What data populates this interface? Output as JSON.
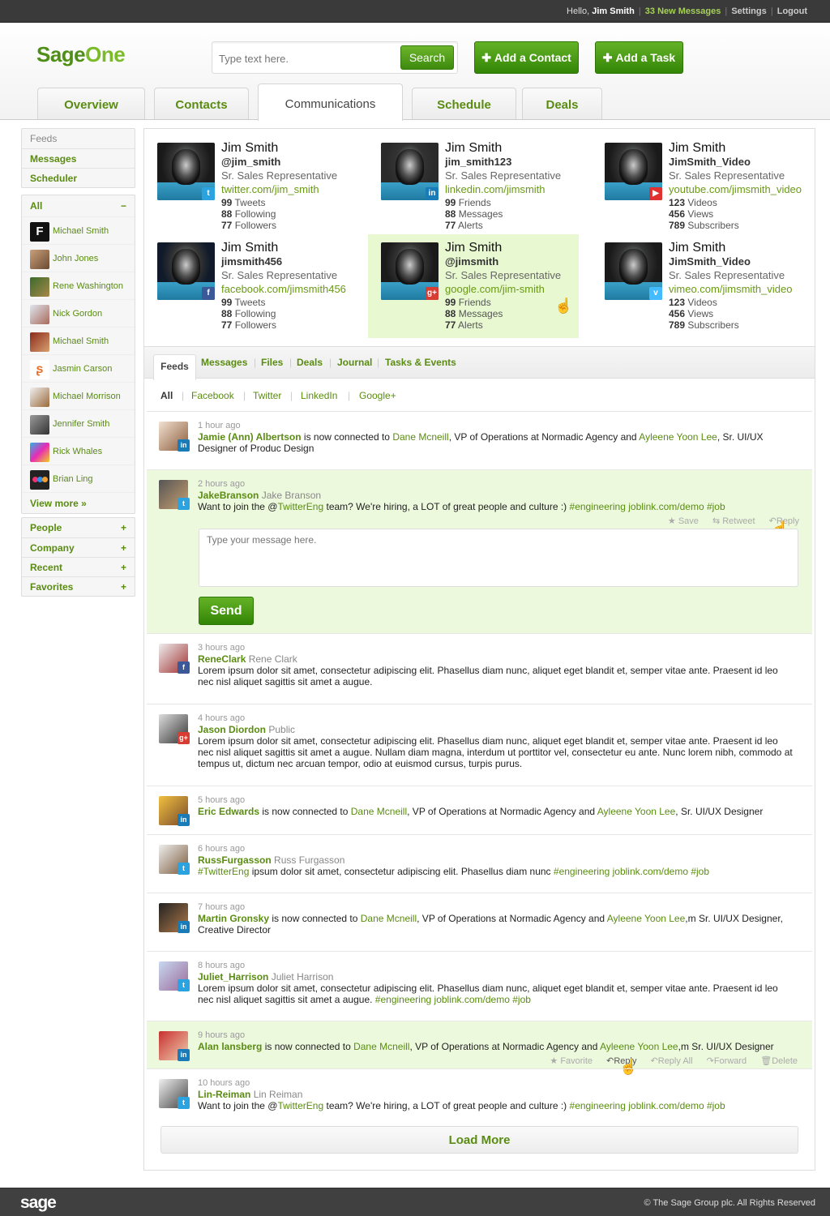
{
  "topbar": {
    "hello": "Hello,",
    "user": "Jim Smith",
    "messages": "33 New Messages",
    "settings": "Settings",
    "logout": "Logout"
  },
  "header": {
    "logo_a": "Sage",
    "logo_b": "One",
    "search_placeholder": "Type text here.",
    "search_label": "Search",
    "add_contact": "Add a Contact",
    "add_task": "Add a Task"
  },
  "tabs": [
    "Overview",
    "Contacts",
    "Communications",
    "Schedule",
    "Deals"
  ],
  "sidebar": {
    "nav": [
      "Feeds",
      "Messages",
      "Scheduler"
    ],
    "all_label": "All",
    "all_toggle": "−",
    "people": [
      "Michael Smith",
      "John Jones",
      "Rene Washington",
      "Nick Gordon",
      "Michael Smith",
      "Jasmin Carson",
      "Michael Morrison",
      "Jennifer Smith",
      "Rick Whales",
      "Brian Ling"
    ],
    "view_more": "View more »",
    "groups": [
      "People",
      "Company",
      "Recent",
      "Favorites"
    ],
    "group_toggle": "+"
  },
  "profiles": [
    {
      "name": "Jim Smith",
      "handle": "@jim_smith",
      "role": "Sr. Sales Representative",
      "url": "twitter.com/jim_smith",
      "s1n": "99",
      "s1": "Tweets",
      "s2n": "88",
      "s2": "Following",
      "s3n": "77",
      "s3": "Followers",
      "net": "twitter",
      "color": "#2aa3e0"
    },
    {
      "name": "Jim Smith",
      "handle": "jim_smith123",
      "role": "Sr. Sales Representative",
      "url": "linkedin.com/jimsmith",
      "s1n": "99",
      "s1": "Friends",
      "s2n": "88",
      "s2": "Messages",
      "s3n": "77",
      "s3": "Alerts",
      "net": "linkedin",
      "color": "#1a7bb9"
    },
    {
      "name": "Jim Smith",
      "handle": "JimSmith_Video",
      "role": "Sr. Sales Representative",
      "url": "youtube.com/jimsmith_video",
      "s1n": "123",
      "s1": "Videos",
      "s2n": "456",
      "s2": "Views",
      "s3n": "789",
      "s3": "Subscribers",
      "net": "youtube",
      "color": "#e03030"
    },
    {
      "name": "Jim Smith",
      "handle": "jimsmith456",
      "role": "Sr. Sales Representative",
      "url": "facebook.com/jimsmith456",
      "s1n": "99",
      "s1": "Tweets",
      "s2n": "88",
      "s2": "Following",
      "s3n": "77",
      "s3": "Followers",
      "net": "facebook",
      "color": "#3b5998"
    },
    {
      "name": "Jim Smith",
      "handle": "@jimsmith",
      "role": "Sr. Sales Representative",
      "url": "google.com/jim-smith",
      "s1n": "99",
      "s1": "Friends",
      "s2n": "88",
      "s2": "Messages",
      "s3n": "77",
      "s3": "Alerts",
      "net": "google-plus",
      "color": "#d73d32"
    },
    {
      "name": "Jim Smith",
      "handle": "JimSmith_Video",
      "role": "Sr. Sales Representative",
      "url": "vimeo.com/jimsmith_video",
      "s1n": "123",
      "s1": "Videos",
      "s2n": "456",
      "s2": "Views",
      "s3n": "789",
      "s3": "Subscribers",
      "net": "vimeo",
      "color": "#44bbff"
    }
  ],
  "subtabs": [
    "Feeds",
    "Messages",
    "Files",
    "Deals",
    "Journal",
    "Tasks & Events"
  ],
  "filters": [
    "All",
    "Facebook",
    "Twitter",
    "LinkedIn",
    "Google+"
  ],
  "feed": [
    {
      "time": "1 hour ago",
      "who": "Jamie (Ann) Albertson",
      "p1": " is now connected to ",
      "l1": "Dane Mcneill",
      "p2": ", VP of Operations at Normadic Agency and ",
      "l2": "Ayleene Yoon Lee",
      "p3": ", Sr. UI/UX Designer of Produc Design"
    },
    {
      "time": "2 hours ago",
      "who": "JakeBranson",
      "alt": "Jake Branson",
      "p1": "Want to join the @",
      "l1": "TwitterEng",
      "p2": " team? We're hiring, a LOT of great people and culture :) ",
      "l2": "#engineering joblink.com/demo #job",
      "a1": "Save",
      "a2": "Retweet",
      "a3": "Reply",
      "reply_placeholder": "Type your message here.",
      "send": "Send"
    },
    {
      "time": "3 hours ago",
      "who": "ReneClark",
      "alt": "Rene Clark",
      "p1": "Lorem ipsum dolor sit amet, consectetur adipiscing elit. Phasellus diam nunc, aliquet eget blandit et, semper vitae ante. Praesent id leo nec nisl aliquet sagittis sit amet a augue."
    },
    {
      "time": "4 hours ago",
      "who": "Jason Diordon",
      "alt": "Public",
      "p1": "Lorem ipsum dolor sit amet, consectetur adipiscing elit. Phasellus diam nunc, aliquet eget blandit et, semper vitae ante. Praesent id leo nec nisl aliquet sagittis sit amet a augue. Nullam diam magna, interdum ut porttitor vel, consectetur eu ante. Nunc lorem nibh, commodo at tempus ut, dictum nec arcuan tempor, odio at euismod cursus, turpis purus."
    },
    {
      "time": "5 hours ago",
      "who": "Eric Edwards",
      "p1": " is now connected to ",
      "l1": "Dane Mcneill",
      "p2": ", VP of Operations at Normadic Agency and ",
      "l2": "Ayleene Yoon Lee",
      "p3": ", Sr. UI/UX Designer"
    },
    {
      "time": "6 hours ago",
      "who": "RussFurgasson",
      "alt": "Russ Furgasson",
      "l0": "#TwitterEng",
      "p1": " ipsum dolor sit amet, consectetur adipiscing elit. Phasellus diam nunc ",
      "l1": "#engineering joblink.com/demo #job"
    },
    {
      "time": "7 hours ago",
      "who": "Martin Gronsky",
      "p1": " is now connected to ",
      "l1": "Dane Mcneill",
      "p2": ", VP of Operations at Normadic Agency and ",
      "l2": "Ayleene Yoon Lee",
      "p3": ",m Sr. UI/UX Designer, Creative Director"
    },
    {
      "time": "8 hours ago",
      "who": "Juliet_Harrison",
      "alt": "Juliet Harrison",
      "p1": "Lorem ipsum dolor sit amet, consectetur adipiscing elit. Phasellus diam nunc, aliquet eget blandit et, semper vitae ante. Praesent id leo nec nisl aliquet sagittis sit amet a augue. ",
      "l1": "#engineering joblink.com/demo #job"
    },
    {
      "time": "9 hours ago",
      "who": "Alan lansberg",
      "p1": " is now connected to ",
      "l1": "Dane Mcneill",
      "p2": ", VP of Operations at Normadic Agency and ",
      "l2": "Ayleene Yoon Lee",
      "p3": ",m Sr. UI/UX Designer",
      "a1": "Favorite",
      "a2": "Reply",
      "a3": "Reply All",
      "a4": "Forward",
      "a5": "Delete"
    },
    {
      "time": "10 hours ago",
      "who": "Lin-Reiman",
      "alt": "Lin Reiman",
      "p1": "Want to join the @",
      "l1": "TwitterEng",
      "p2": " team? We're hiring, a LOT of great people and culture :) ",
      "l2": "#engineering joblink.com/demo #job"
    }
  ],
  "load_more": "Load More",
  "footer": {
    "logo": "sage",
    "copyright": "© The Sage Group plc. All Rights Reserved"
  }
}
